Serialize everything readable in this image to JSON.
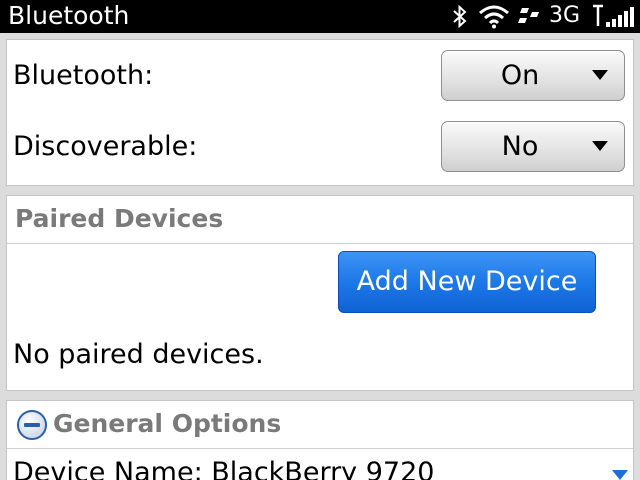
{
  "status_bar": {
    "title": "Bluetooth",
    "network_label": "3G",
    "icons": [
      "bluetooth-icon",
      "wifi-icon",
      "cellular-activity-icon",
      "signal-strength-icon"
    ]
  },
  "bluetooth_settings": {
    "bluetooth_label": "Bluetooth:",
    "bluetooth_value": "On",
    "discoverable_label": "Discoverable:",
    "discoverable_value": "No"
  },
  "paired_devices": {
    "header": "Paired Devices",
    "add_button_label": "Add New Device",
    "empty_message": "No paired devices."
  },
  "general_options": {
    "header": "General Options",
    "device_name_label": "Device Name: BlackBerry 9720"
  },
  "colors": {
    "status_bar_bg": "#000000",
    "primary_button": "#1d78e8",
    "section_header_text": "#7a7a7a",
    "scroll_arrow": "#1a6fd6"
  }
}
